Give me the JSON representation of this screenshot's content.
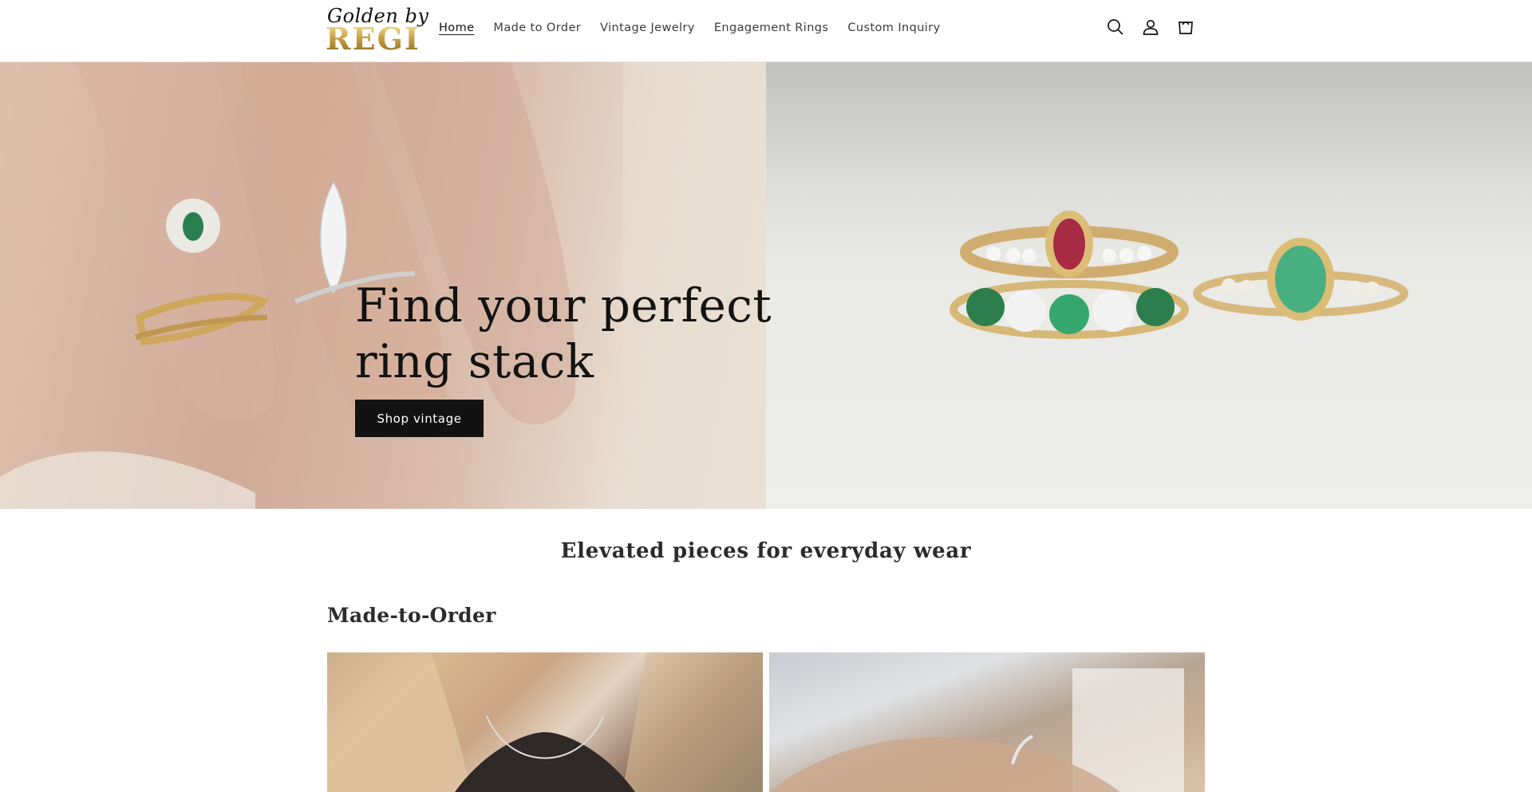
{
  "brand": {
    "logo_script": "Golden by",
    "logo_mark": "REGI"
  },
  "nav": {
    "items": [
      {
        "label": "Home",
        "active": true
      },
      {
        "label": "Made to Order",
        "active": false
      },
      {
        "label": "Vintage Jewelry",
        "active": false
      },
      {
        "label": "Engagement Rings",
        "active": false
      },
      {
        "label": "Custom Inquiry",
        "active": false
      }
    ]
  },
  "header_icons": [
    "search-icon",
    "account-icon",
    "cart-icon"
  ],
  "hero": {
    "title": "Find your perfect ring stack",
    "button_label": "Shop vintage"
  },
  "tagline": "Elevated pieces for everyday wear",
  "section": {
    "title": "Made-to-Order"
  },
  "colors": {
    "primary_text": "#121212",
    "button_bg": "#121212",
    "button_text": "#ffffff",
    "logo_gold": "#c9a84a"
  }
}
